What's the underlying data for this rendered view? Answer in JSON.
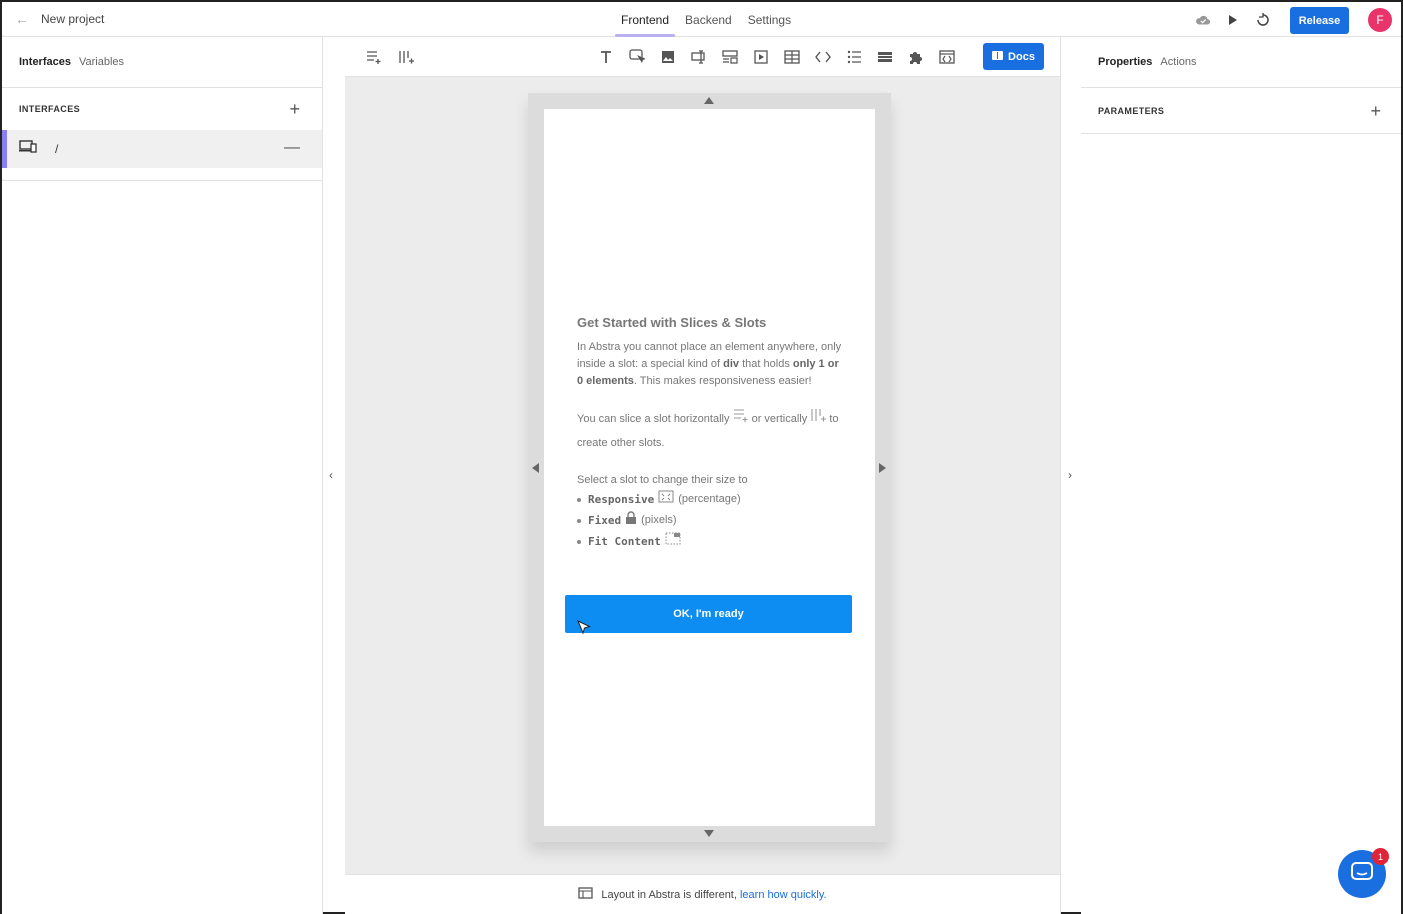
{
  "header": {
    "project_name": "New project",
    "tabs": [
      "Frontend",
      "Backend",
      "Settings"
    ],
    "active_tab": "Frontend",
    "release_label": "Release",
    "avatar_initial": "F"
  },
  "left_panel": {
    "tabs": [
      "Interfaces",
      "Variables"
    ],
    "section_title": "INTERFACES",
    "interfaces": [
      {
        "path": "/"
      }
    ]
  },
  "canvas": {
    "docs_label": "Docs",
    "guide": {
      "title": "Get Started with Slices & Slots",
      "p1_part1": "In Abstra you cannot place an element anywhere, only inside a slot: a special kind of",
      "p1_code": "div",
      "p1_part2": "that holds",
      "p1_bold": "only 1 or 0 elements",
      "p1_part3": ". This makes responsiveness easier!",
      "p2_part1": "You can slice a slot horizontally",
      "p2_part2": "or vertically",
      "p2_part3": "to create other slots.",
      "p3": "Select a slot to change their size to",
      "options": [
        {
          "name": "Responsive",
          "note": "(percentage)"
        },
        {
          "name": "Fixed",
          "note": "(pixels)"
        },
        {
          "name": "Fit Content",
          "note": ""
        }
      ],
      "ok_label": "OK, I'm ready"
    },
    "bottom_text": "Layout in Abstra is different,",
    "bottom_link": "learn how quickly."
  },
  "right_panel": {
    "tabs": [
      "Properties",
      "Actions"
    ],
    "section_title": "PARAMETERS"
  },
  "chat": {
    "badge_count": "1"
  },
  "colors": {
    "accent": "#1a6fe0",
    "ok_button": "#0d8cf2",
    "tab_underline": "#b8b0f0",
    "avatar": "#e8336b"
  }
}
